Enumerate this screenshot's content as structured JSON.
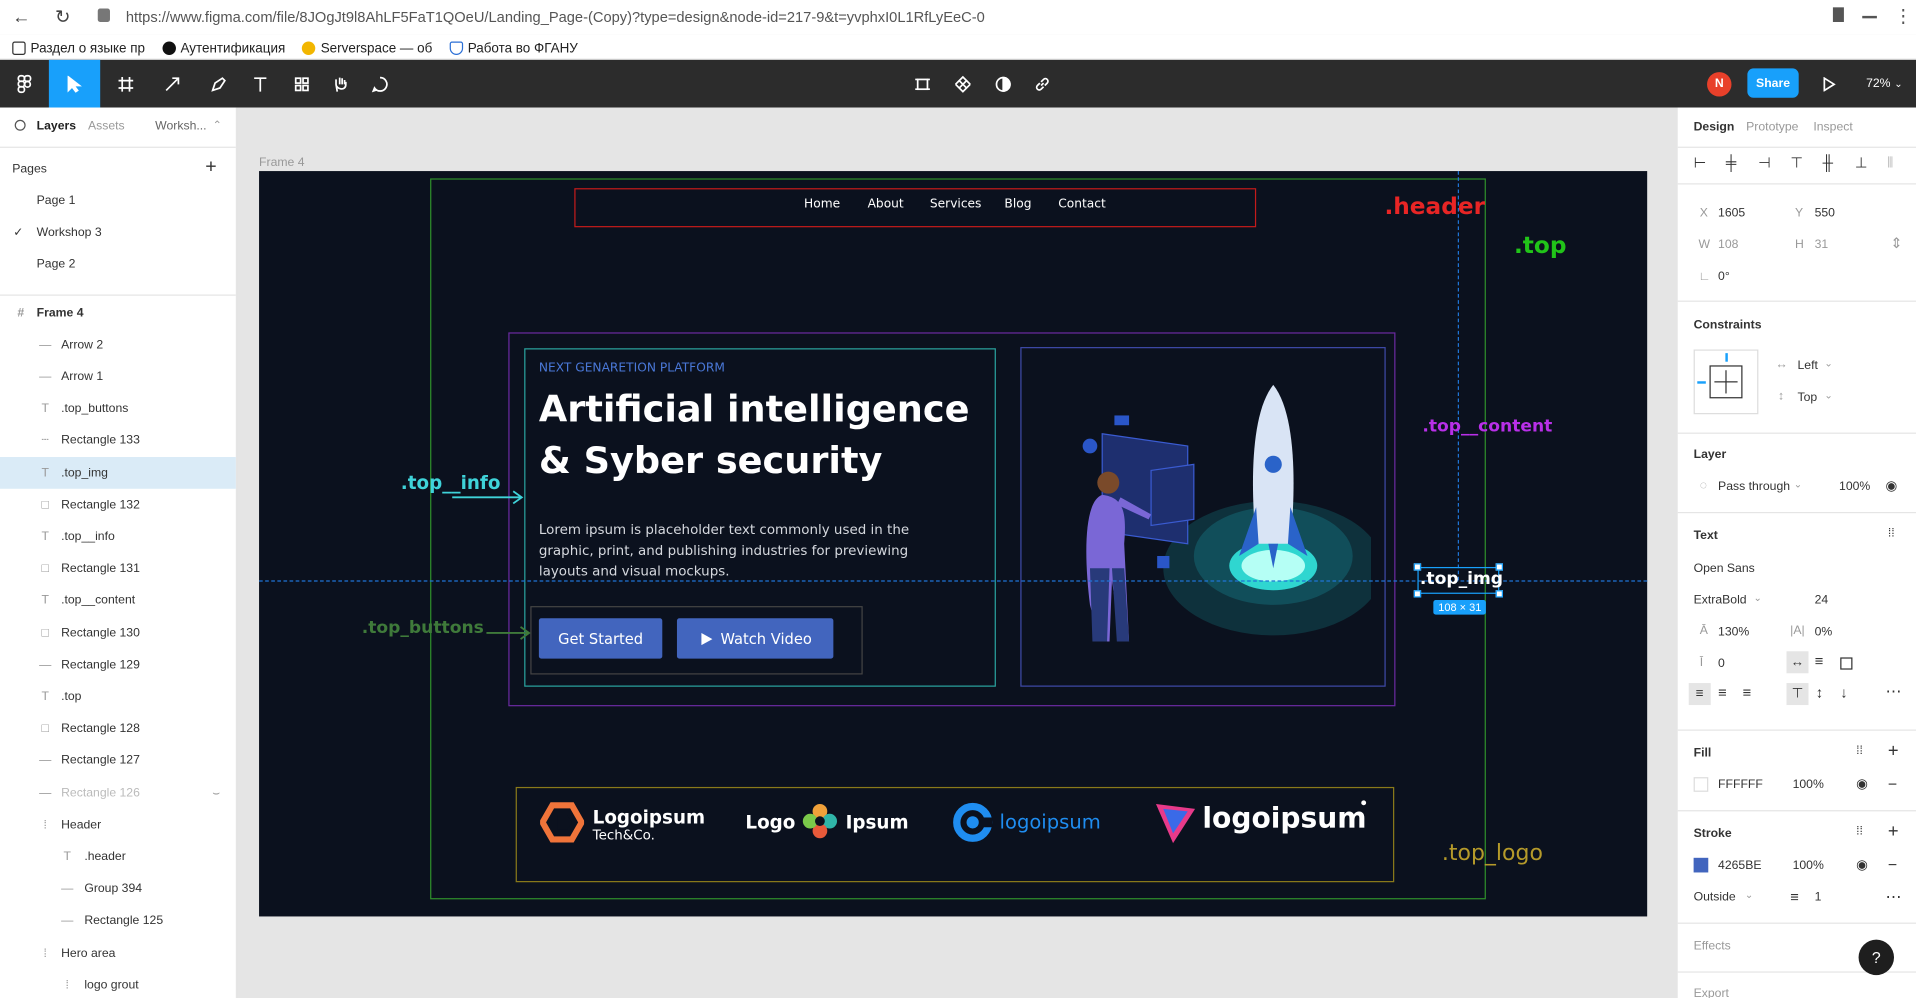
{
  "browser": {
    "url": "https://www.figma.com/file/8JOgJt9l8AhLF5FaT1QOeU/Landing_Page-(Copy)?type=design&node-id=217-9&t=yvphxI0L1RfLyEeC-0",
    "bookmarks": [
      "Раздел о языке пр",
      "Аутентификация",
      "Serverspace — об",
      "Работа во ФГАНУ"
    ]
  },
  "toolbar": {
    "share_label": "Share",
    "zoom": "72%",
    "avatar_initial": "N"
  },
  "left_panel": {
    "tabs": [
      "Layers",
      "Assets",
      "Worksh..."
    ],
    "pages_title": "Pages",
    "pages": [
      "Page 1",
      "Workshop 3",
      "Page 2"
    ],
    "layers": [
      {
        "label": "Frame 4",
        "icon": "frame-icon"
      },
      {
        "label": "Arrow 2",
        "icon": "line-icon"
      },
      {
        "label": "Arrow 1",
        "icon": "line-icon"
      },
      {
        "label": ".top_buttons",
        "icon": "text-icon"
      },
      {
        "label": "Rectangle 133",
        "icon": "dashed-line-icon"
      },
      {
        "label": ".top_img",
        "icon": "text-icon"
      },
      {
        "label": "Rectangle 132",
        "icon": "rectangle-icon"
      },
      {
        "label": ".top__info",
        "icon": "text-icon"
      },
      {
        "label": "Rectangle 131",
        "icon": "rectangle-icon"
      },
      {
        "label": ".top__content",
        "icon": "text-icon"
      },
      {
        "label": "Rectangle 130",
        "icon": "rectangle-icon"
      },
      {
        "label": "Rectangle 129",
        "icon": "line-icon"
      },
      {
        "label": ".top",
        "icon": "text-icon"
      },
      {
        "label": "Rectangle 128",
        "icon": "rectangle-icon"
      },
      {
        "label": "Rectangle 127",
        "icon": "line-icon"
      },
      {
        "label": "Rectangle 126",
        "icon": "line-icon"
      },
      {
        "label": "Header",
        "icon": "group-icon"
      },
      {
        "label": ".header",
        "icon": "text-icon"
      },
      {
        "label": "Group 394",
        "icon": "line-icon"
      },
      {
        "label": "Rectangle 125",
        "icon": "line-icon"
      },
      {
        "label": "Hero area",
        "icon": "group-icon"
      },
      {
        "label": "logo grout",
        "icon": "group-icon"
      }
    ]
  },
  "canvas": {
    "frame_label": "Frame 4",
    "nav": [
      "Home",
      "About",
      "Services",
      "Blog",
      "Contact"
    ],
    "eyebrow": "NEXT GENARETION PLATFORM",
    "headline_1": "Artificial intelligence",
    "headline_2": "& Syber security",
    "body": "Lorem ipsum is placeholder text commonly used in the graphic, print, and publishing industries for previewing layouts and visual mockups.",
    "btn_primary": "Get Started",
    "btn_secondary": "Watch Video",
    "annotations": {
      "header": ".header",
      "top": ".top",
      "top_content": ".top__content",
      "top_info": ".top__info",
      "top_buttons": ".top_buttons",
      "top_img": ".top_img",
      "top_logo": ".top_logo",
      "size_badge": "108 × 31"
    },
    "logos": {
      "l1_a": "Logoipsum",
      "l1_b": "Tech&Co.",
      "l2_a": "Logo",
      "l2_b": "Ipsum",
      "l3": "logoipsum",
      "l4": "logoipsum"
    }
  },
  "right_panel": {
    "tabs": [
      "Design",
      "Prototype",
      "Inspect"
    ],
    "x_label": "X",
    "x": "1605",
    "y_label": "Y",
    "y": "550",
    "w_label": "W",
    "w": "108",
    "h_label": "H",
    "h": "31",
    "rotation": "0°",
    "constraints_title": "Constraints",
    "constraint_h": "Left",
    "constraint_v": "Top",
    "layer_title": "Layer",
    "blend": "Pass through",
    "layer_opacity": "100%",
    "text_title": "Text",
    "font": "Open Sans",
    "weight": "ExtraBold",
    "size": "24",
    "line_height": "130%",
    "letter_spacing": "0%",
    "para_spacing": "0",
    "fill_title": "Fill",
    "fill_hex": "FFFFFF",
    "fill_opacity": "100%",
    "stroke_title": "Stroke",
    "stroke_hex": "4265BE",
    "stroke_opacity": "100%",
    "stroke_pos": "Outside",
    "stroke_width": "1",
    "effects_title": "Effects",
    "export_title": "Export"
  },
  "colors": {
    "accent": "#18a0fb",
    "frame_bg": "#0b111e",
    "button": "#4265be",
    "header_ann": "#e82525",
    "top_ann": "#21c419",
    "content_ann": "#b82fe8",
    "info_ann": "#3fd3d9",
    "buttons_ann": "#3f7a3a",
    "logo_ann": "#b59a2a"
  }
}
